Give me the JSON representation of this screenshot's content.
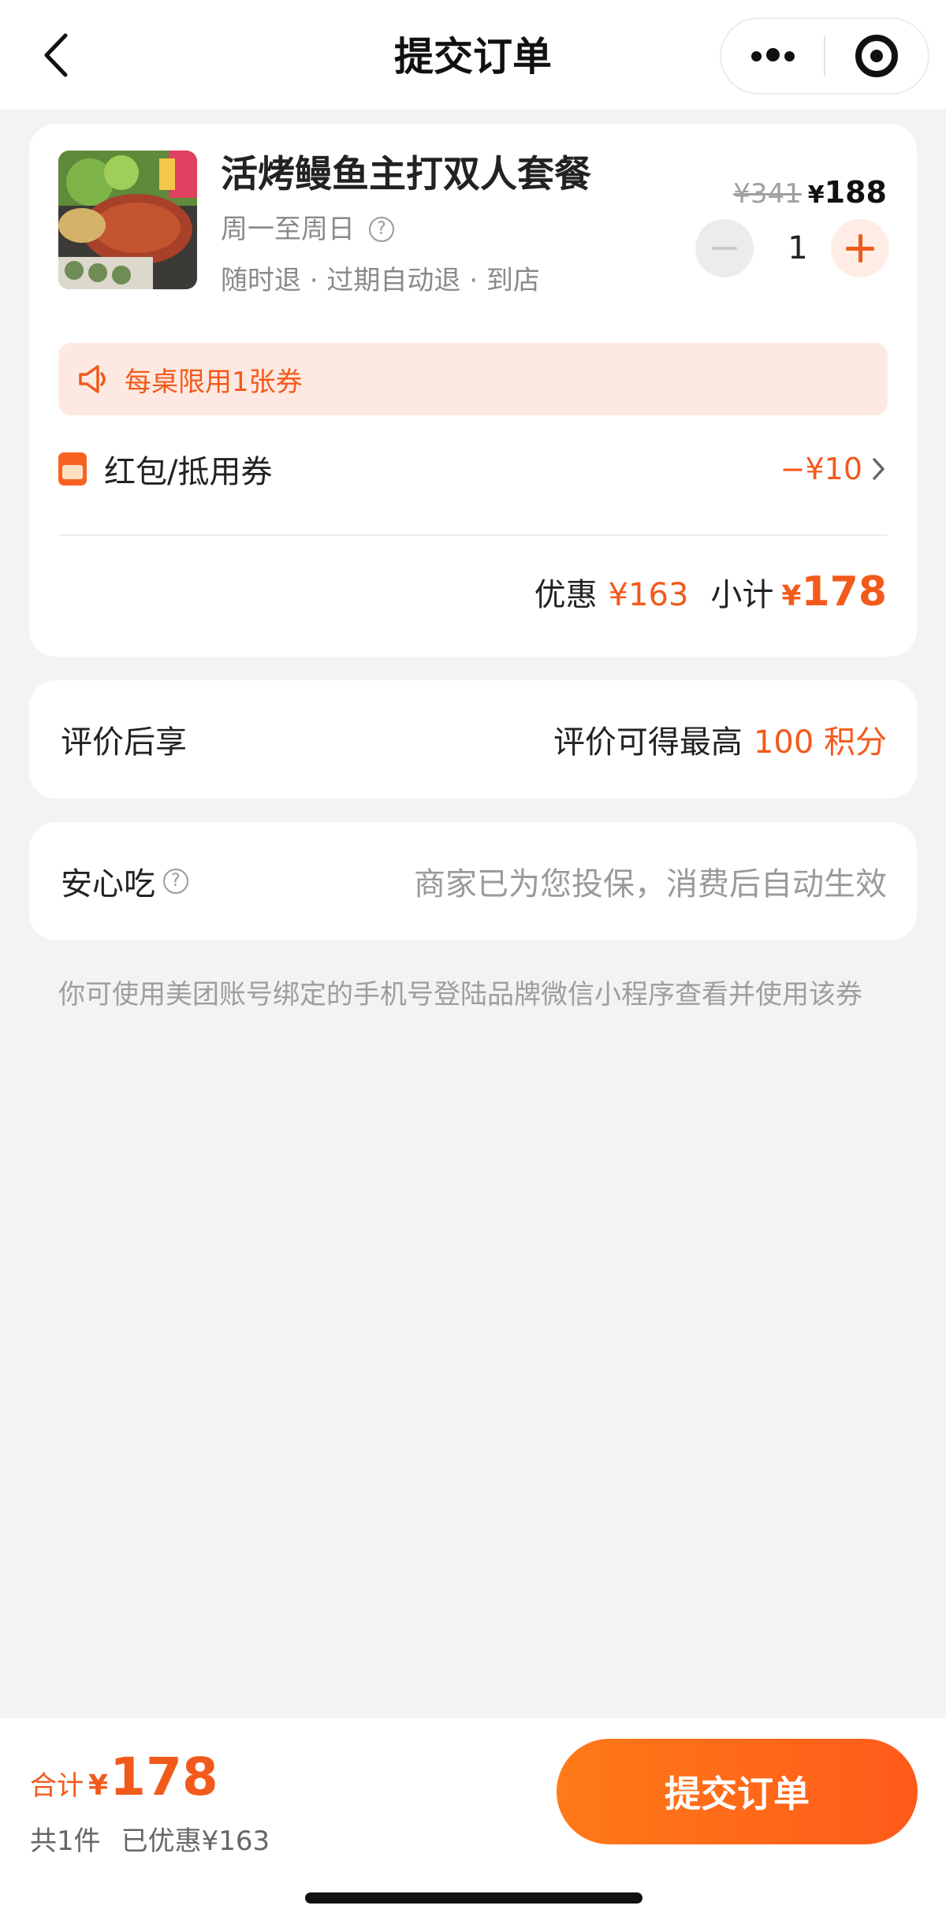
{
  "header": {
    "title": "提交订单",
    "back_icon": "chevron-left-icon",
    "more_icon": "more-dots-icon",
    "target_icon": "target-icon"
  },
  "product": {
    "name": "活烤鳗鱼主打双人套餐",
    "days": "周一至周日",
    "help_glyph": "?",
    "tags": "随时退 · 过期自动退 · 到店",
    "original_price": "¥341",
    "price_yen": "¥",
    "price": "188",
    "quantity": "1"
  },
  "notice": {
    "text": "每桌限用1张券"
  },
  "coupon": {
    "label": "红包/抵用券",
    "value": "−¥10"
  },
  "summary": {
    "discount_label": "优惠",
    "discount_value": "¥163",
    "subtotal_label": "小计",
    "subtotal_yen": "¥",
    "subtotal_value": "178"
  },
  "review": {
    "label": "评价后享",
    "text": "评价可得最高",
    "points": "100 积分"
  },
  "safe_eat": {
    "label": "安心吃",
    "help_glyph": "?",
    "description": "商家已为您投保，消费后自动生效"
  },
  "footnote": "你可使用美团账号绑定的手机号登陆品牌微信小程序查看并使用该券",
  "bottom_bar": {
    "total_label": "合计",
    "total_yen": "¥",
    "total_value": "178",
    "count_text": "共1件",
    "saved_text": "已优惠¥163",
    "submit_label": "提交订单"
  },
  "colors": {
    "accent": "#f25a1c",
    "button_gradient_start": "#ff7a18",
    "button_gradient_end": "#ff5a1a",
    "notice_bg": "#fde9e1",
    "page_bg": "#f3f3f3"
  }
}
